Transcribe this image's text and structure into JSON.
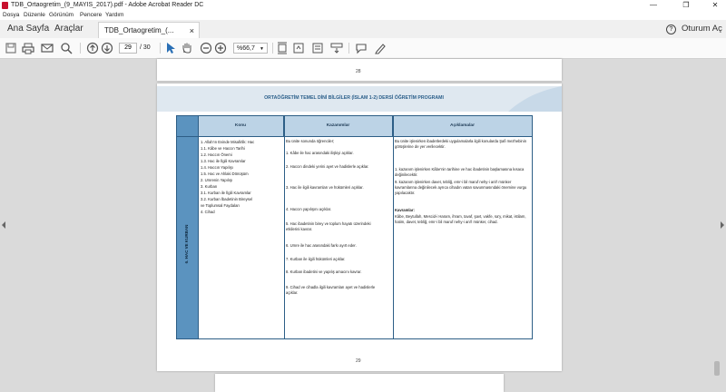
{
  "window": {
    "title": "TDB_Ortaogretim_(9_MAYIS_2017).pdf - Adobe Acrobat Reader DC",
    "minimize": "—",
    "maximize": "❐",
    "close": "✕"
  },
  "menu": [
    "Dosya",
    "Düzenle",
    "Görünüm",
    "Pencere",
    "Yardım"
  ],
  "nav": {
    "home": "Ana Sayfa",
    "tools": "Araçlar",
    "doc_tab": "TDB_Ortaogretim_(...",
    "doc_tab_close": "×",
    "sign_in": "Oturum Aç"
  },
  "toolbar": {
    "page_current": "29",
    "page_total": "/ 30",
    "zoom": "%66,7"
  },
  "page_numbers": {
    "top": "28",
    "bottom": "29"
  },
  "document": {
    "title": "ORTAÖĞRETİM TEMEL DİNİ BİLGİLER (İSLAM 1-2) DERSİ ÖĞRETİM PROGRAMI",
    "unit": "6. HAC VE KURBAN",
    "headers": [
      "Konu",
      "Kazanımlar",
      "Açıklamalar"
    ],
    "topics": [
      "1.  Allah'ın Evinde Misafirlik: Hac",
      "      1.1. Kâbe ve Haccın Tarihi",
      "      1.2. Haccın Önemi",
      "      1.3. Hac ile İlgili Kavramlar",
      "      1.4. Haccın Yapılışı",
      "      1.5. Hac ve Ahlaki Dönüşüm",
      "2.  Umrenin Yapılışı",
      "3.  Kurban",
      "      3.1. Kurban ile İlgili Kavramlar",
      "      3.2. Kurban İbadetinin Bireysel",
      "             ve Toplumsal Faydaları",
      "4.  Cihad"
    ],
    "outcomes_intro": "Bu ünite sonunda öğrenciler;",
    "outcomes": [
      "1.   Kâbe ile hac arasındaki ilişkiyi açıklar.",
      "2.   Haccın dindeki yerini ayet ve hadislerle açıklar.",
      "3.   Hac ile ilgili kavramları ve hükümleri açıklar.",
      "4.   Haccın yapılışını açıklar.",
      "5.   Hac ibadetinin birey ve toplum hayatı üzerindeki etkilerini kavrar.",
      "6.   Umre ile hac arasındaki farkı ayırt eder.",
      "7.   Kurban ile ilgili hükümleri açıklar.",
      "8.   Kurban ibadetini ve yapılış amacını kavrar.",
      "9.   Cihad ve cihadla ilgili kavramları ayet ve hadislerle açıklar."
    ],
    "notes_1": "Bu ünite işlenirken ibadetlerdeki uygulamalarla ilgili konularda Şafi mezhebinin görüşlerine de yer verilecektir.",
    "notes_2": "1. kazanım işlenirken Kâbe'nin tarihine ve hac ibadetinin başlamasına kısaca değinilecektir.",
    "notes_3": "9. kazanım işlenirken davet, tebliğ, emr-i bil maruf nehy-i ani'l münker kavramlarına değinilecek ayrıca cihadın vatan savunmasındaki önemine vurgu yapılacaktır.",
    "concepts_title": "Kavramlar:",
    "concepts": "Kâbe, Beytullah, Mescid-i Haram, ihram, tavaf, şavt, vakfe, sa'y, mikat, istilam, hatim, davet, tebliğ, emr-i bil maruf nehy-i ani'l münker, cihad."
  }
}
